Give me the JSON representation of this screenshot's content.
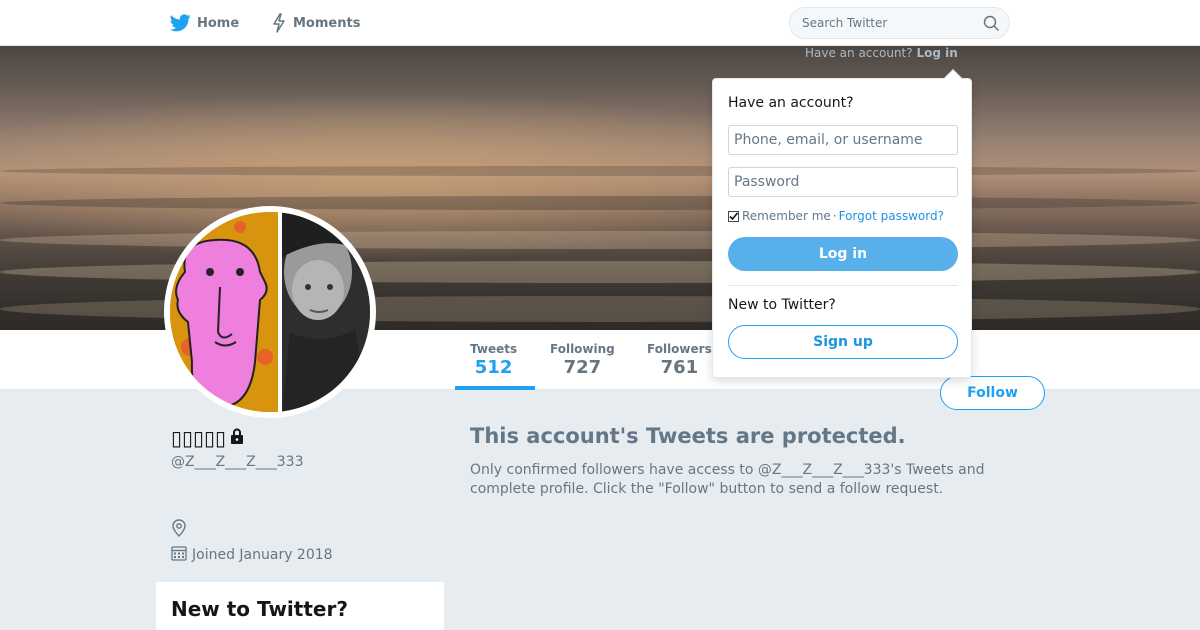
{
  "topnav": {
    "home_label": "Home",
    "moments_label": "Moments",
    "search_placeholder": "Search Twitter",
    "login_hint_prefix": "Have an account?",
    "login_hint_link": "Log in"
  },
  "profile": {
    "display_name": "▯▯▯▯▯",
    "handle": "@Z___Z___Z___333",
    "joined": "Joined January 2018"
  },
  "stats": [
    {
      "label": "Tweets",
      "value": "512"
    },
    {
      "label": "Following",
      "value": "727"
    },
    {
      "label": "Followers",
      "value": "761"
    }
  ],
  "follow_label": "Follow",
  "protected": {
    "title": "This account's Tweets are protected.",
    "body": "Only confirmed followers have access to @Z___Z___Z___333's Tweets and complete profile. Click the \"Follow\" button to send a follow request."
  },
  "sidebar_card": {
    "title": "New to Twitter?"
  },
  "login_dropdown": {
    "heading": "Have an account?",
    "username_placeholder": "Phone, email, or username",
    "password_placeholder": "Password",
    "remember_label": "Remember me",
    "separator": "·",
    "forgot_label": "Forgot password?",
    "login_label": "Log in",
    "new_heading": "New to Twitter?",
    "signup_label": "Sign up"
  },
  "colors": {
    "brand_blue": "#1da1f2",
    "text_secondary": "#657786",
    "page_background": "#e6ecf0"
  },
  "icons": {
    "home": "twitter-bird-icon",
    "moments": "lightning-icon",
    "search": "search-icon",
    "lock": "lock-icon",
    "location": "location-pin-icon",
    "calendar": "calendar-icon"
  }
}
